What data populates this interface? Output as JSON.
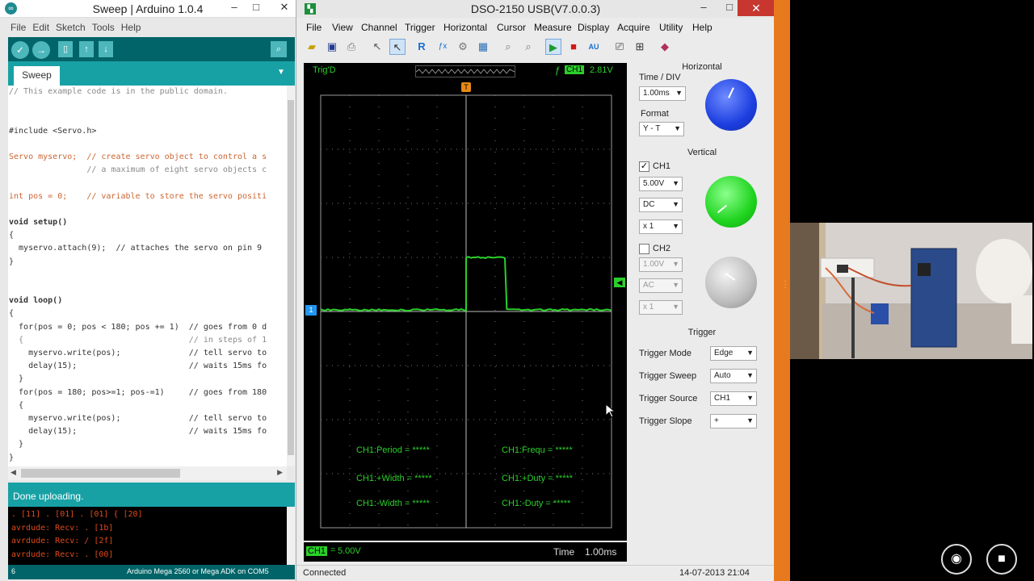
{
  "arduino": {
    "title": "Sweep | Arduino 1.0.4",
    "app_icon": "arduino-logo",
    "menu": [
      "File",
      "Edit",
      "Sketch",
      "Tools",
      "Help"
    ],
    "tab": "Sweep",
    "code": [
      {
        "t": "// This example code is in the public domain.",
        "c": "cm"
      },
      {
        "t": "",
        "c": ""
      },
      {
        "t": "",
        "c": ""
      },
      {
        "t": "#include <Servo.h>",
        "c": "inc"
      },
      {
        "t": "",
        "c": ""
      },
      {
        "t": "Servo myservo;  // create servo object to control a s",
        "c": "decl"
      },
      {
        "t": "                // a maximum of eight servo objects c",
        "c": "cm"
      },
      {
        "t": "",
        "c": ""
      },
      {
        "t": "int pos = 0;    // variable to store the servo positi",
        "c": "int"
      },
      {
        "t": "",
        "c": ""
      },
      {
        "t": "void setup()",
        "c": "fn"
      },
      {
        "t": "{",
        "c": ""
      },
      {
        "t": "  myservo.attach(9);  // attaches the servo on pin 9",
        "c": "call"
      },
      {
        "t": "}",
        "c": ""
      },
      {
        "t": "",
        "c": ""
      },
      {
        "t": "",
        "c": ""
      },
      {
        "t": "void loop()",
        "c": "fn"
      },
      {
        "t": "{",
        "c": ""
      },
      {
        "t": "  for(pos = 0; pos < 180; pos += 1)  // goes from 0 d",
        "c": "for"
      },
      {
        "t": "  {                                  // in steps of 1",
        "c": "cm"
      },
      {
        "t": "    myservo.write(pos);              // tell servo to",
        "c": "call"
      },
      {
        "t": "    delay(15);                       // waits 15ms fo",
        "c": "call"
      },
      {
        "t": "  }",
        "c": ""
      },
      {
        "t": "  for(pos = 180; pos>=1; pos-=1)     // goes from 180",
        "c": "for"
      },
      {
        "t": "  {",
        "c": ""
      },
      {
        "t": "    myservo.write(pos);              // tell servo to",
        "c": "call"
      },
      {
        "t": "    delay(15);                       // waits 15ms fo",
        "c": "call"
      },
      {
        "t": "  }",
        "c": ""
      },
      {
        "t": "}",
        "c": ""
      }
    ],
    "status": "Done uploading.",
    "console": [
      ". [11] . [01] . [01] { [20]",
      "avrdude: Recv: . [1b]",
      "avrdude: Recv: / [2f]",
      "avrdude: Recv: . [00]"
    ],
    "line_no": "6",
    "board": "Arduino Mega 2560 or Mega ADK on COM5",
    "colors": {
      "teal_dark": "#006468",
      "teal": "#17a1a5",
      "console_text": "#e04a1a"
    }
  },
  "dso": {
    "title": "DSO-2150 USB(V7.0.0.3)",
    "menu": [
      "File",
      "View",
      "Channel",
      "Trigger",
      "Horizontal",
      "Cursor",
      "Measure",
      "Display",
      "Acquire",
      "Utility",
      "Help"
    ],
    "trig_state": "Trig'D",
    "trig_level": "2.81V",
    "trig_channel": "CH1",
    "ch1_marker": "1",
    "trig_marker": "T",
    "measurements": {
      "period": "CH1:Period = *****",
      "freq": "CH1:Frequ = *****",
      "pwidth": "CH1:+Width = *****",
      "pduty": "CH1:+Duty = *****",
      "nwidth": "CH1:-Width = *****",
      "nduty": "CH1:-Duty = *****"
    },
    "footer_ch": "CH1",
    "footer_volt": "5.00V",
    "footer_time_label": "Time",
    "footer_time_value": "1.00ms",
    "status_left": "Connected",
    "status_right": "14-07-2013  21:04",
    "horizontal": {
      "title": "Horizontal",
      "time_div_label": "Time / DIV",
      "time_div": "1.00ms",
      "format_label": "Format",
      "format": "Y - T"
    },
    "vertical": {
      "title": "Vertical",
      "ch1_label": "CH1",
      "ch1_checked": true,
      "ch1_volt": "5.00V",
      "ch1_coupling": "DC",
      "ch1_probe": "x 1",
      "ch2_label": "CH2",
      "ch2_checked": false,
      "ch2_volt": "1.00V",
      "ch2_coupling": "AC",
      "ch2_probe": "x 1"
    },
    "trigger": {
      "title": "Trigger",
      "mode_label": "Trigger Mode",
      "mode": "Edge",
      "sweep_label": "Trigger Sweep",
      "sweep": "Auto",
      "source_label": "Trigger Source",
      "source": "CH1",
      "slope_label": "Trigger Slope",
      "slope": "+"
    },
    "colors": {
      "trace": "#2ad02a",
      "knob_time": "#2146e8",
      "knob_ch1": "#1fd41f",
      "knob_ch2": "#bdbdbd",
      "trig": "#e88a16"
    }
  },
  "video": {
    "buttons": [
      "snapshot-camera-icon",
      "video-camera-icon"
    ]
  }
}
